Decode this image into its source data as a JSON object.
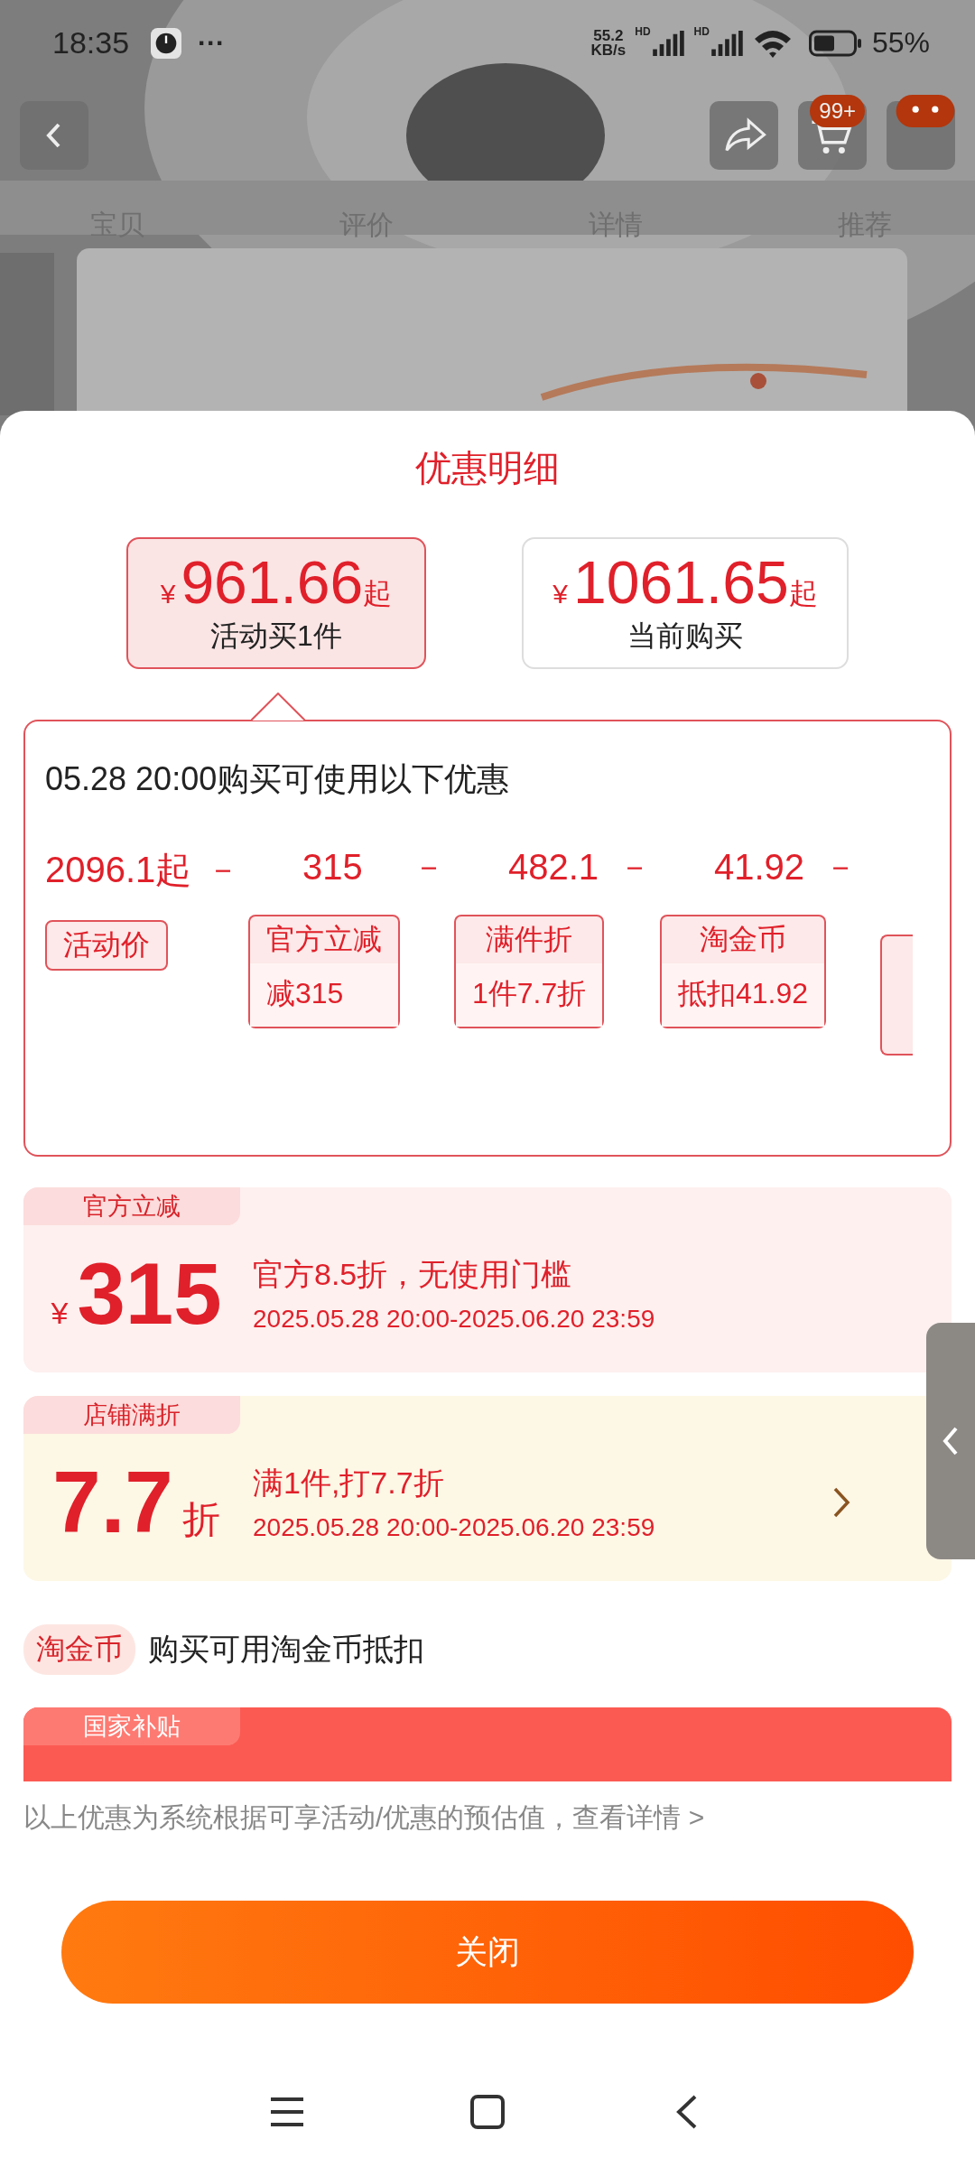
{
  "status_bar": {
    "time": "18:35",
    "more": "···",
    "net_speed": "55.2",
    "net_unit": "KB/s",
    "sim_labels": [
      "HD",
      "HD"
    ],
    "battery": "55%"
  },
  "header": {
    "cart_badge": "99+"
  },
  "tabs": [
    {
      "label": "宝贝"
    },
    {
      "label": "评价"
    },
    {
      "label": "详情"
    },
    {
      "label": "推荐"
    }
  ],
  "sheet": {
    "title": "优惠明细",
    "price_options": [
      {
        "currency": "¥",
        "amount": "961.66",
        "suffix": "起",
        "label": "活动买1件",
        "selected": true
      },
      {
        "currency": "¥",
        "amount": "1061.65",
        "suffix": "起",
        "label": "当前购买",
        "selected": false
      }
    ],
    "breakdown": {
      "heading": "05.28 20:00购买可使用以下优惠",
      "items": [
        {
          "value": "2096.1起",
          "operator": "－",
          "tag": "活动价"
        },
        {
          "value": "315",
          "operator": "－",
          "tag": "官方立减",
          "detail": "减315"
        },
        {
          "value": "482.1",
          "operator": "－",
          "tag": "满件折",
          "detail": "1件7.7折"
        },
        {
          "value": "41.92",
          "operator": "－",
          "tag": "淘金币",
          "detail": "抵扣41.92"
        }
      ]
    },
    "offers": [
      {
        "kind": "official",
        "tag": "官方立减",
        "currency": "¥",
        "amount": "315",
        "title": "官方8.5折，无使用门槛",
        "period": "2025.05.28 20:00-2025.06.20 23:59",
        "has_arrow": false
      },
      {
        "kind": "store",
        "tag": "店铺满折",
        "amount": "7.7",
        "unit": "折",
        "title": "满1件,打7.7折",
        "period": "2025.05.28 20:00-2025.06.20 23:59",
        "has_arrow": true
      }
    ],
    "coin_row": {
      "tag": "淘金币",
      "text": "购买可用淘金币抵扣"
    },
    "subsidy_card": {
      "tag": "国家补贴"
    },
    "note": "以上优惠为系统根据可享活动/优惠的预估值，查看详情 >",
    "close_button": "关闭"
  }
}
